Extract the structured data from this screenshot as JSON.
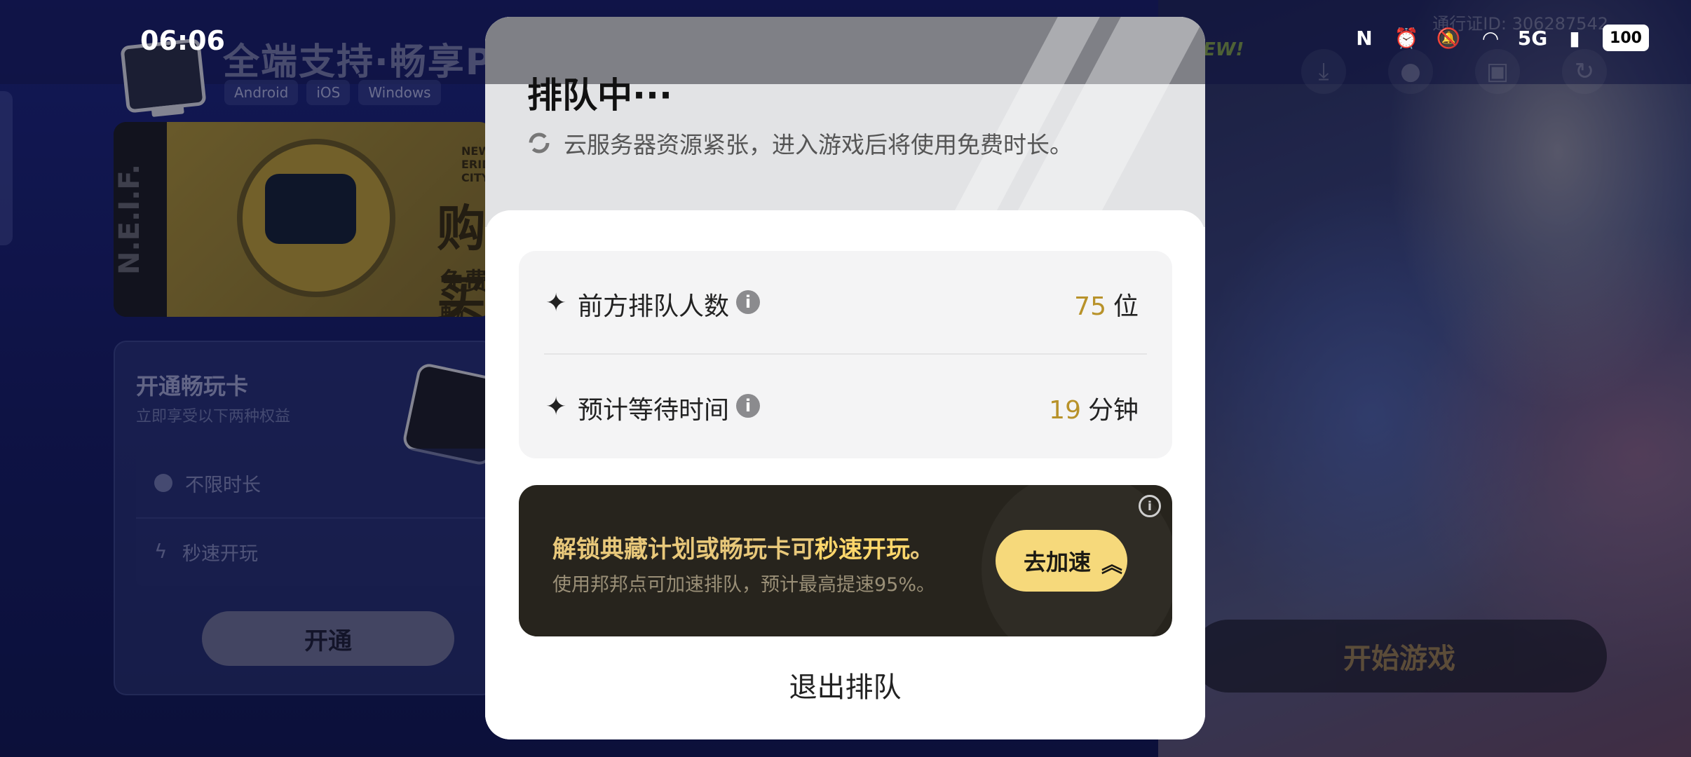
{
  "status_bar": {
    "time": "06:06",
    "network": "5G",
    "battery": "100",
    "icons": [
      "nfc-icon",
      "alarm-icon",
      "mute-icon",
      "wifi-icon",
      "signal-icon"
    ]
  },
  "background_app": {
    "heading": "全端支持·畅享PC",
    "platforms": [
      "Android",
      "iOS",
      "Windows"
    ],
    "new_badge": "EW!",
    "pass_id": "通行证ID: 306287542",
    "promo": {
      "side_text": "N.E.I.F.",
      "city_text": "NEW ERIDU CITY",
      "title": "购买",
      "subtitle": "免费畅",
      "gift_label": "赠"
    },
    "card": {
      "title": "开通畅玩卡",
      "subtitle": "立即享受以下两种权益",
      "benefits": [
        "不限时长",
        "秒速开玩"
      ],
      "button": "开通"
    },
    "start_button": "开始游戏"
  },
  "modal": {
    "title": "排队中···",
    "notice": "云服务器资源紧张，进入游戏后将使用免费时长。",
    "queue": {
      "ahead_label": "前方排队人数",
      "ahead_value": "75",
      "ahead_unit": "位",
      "wait_label": "预计等待时间",
      "wait_value": "19",
      "wait_unit": "分钟"
    },
    "boost": {
      "line1_prefix": "解锁典藏计划或畅玩卡可",
      "line1_highlight": "秒速开玩",
      "line1_suffix": "。",
      "line2": "使用邦邦点可加速排队，预计最高提速95%。",
      "button": "去加速"
    },
    "exit": "退出排队"
  },
  "colors": {
    "accent_gold": "#b8922a",
    "boost_bg": "#27241d",
    "boost_button": "#f6d97b"
  }
}
